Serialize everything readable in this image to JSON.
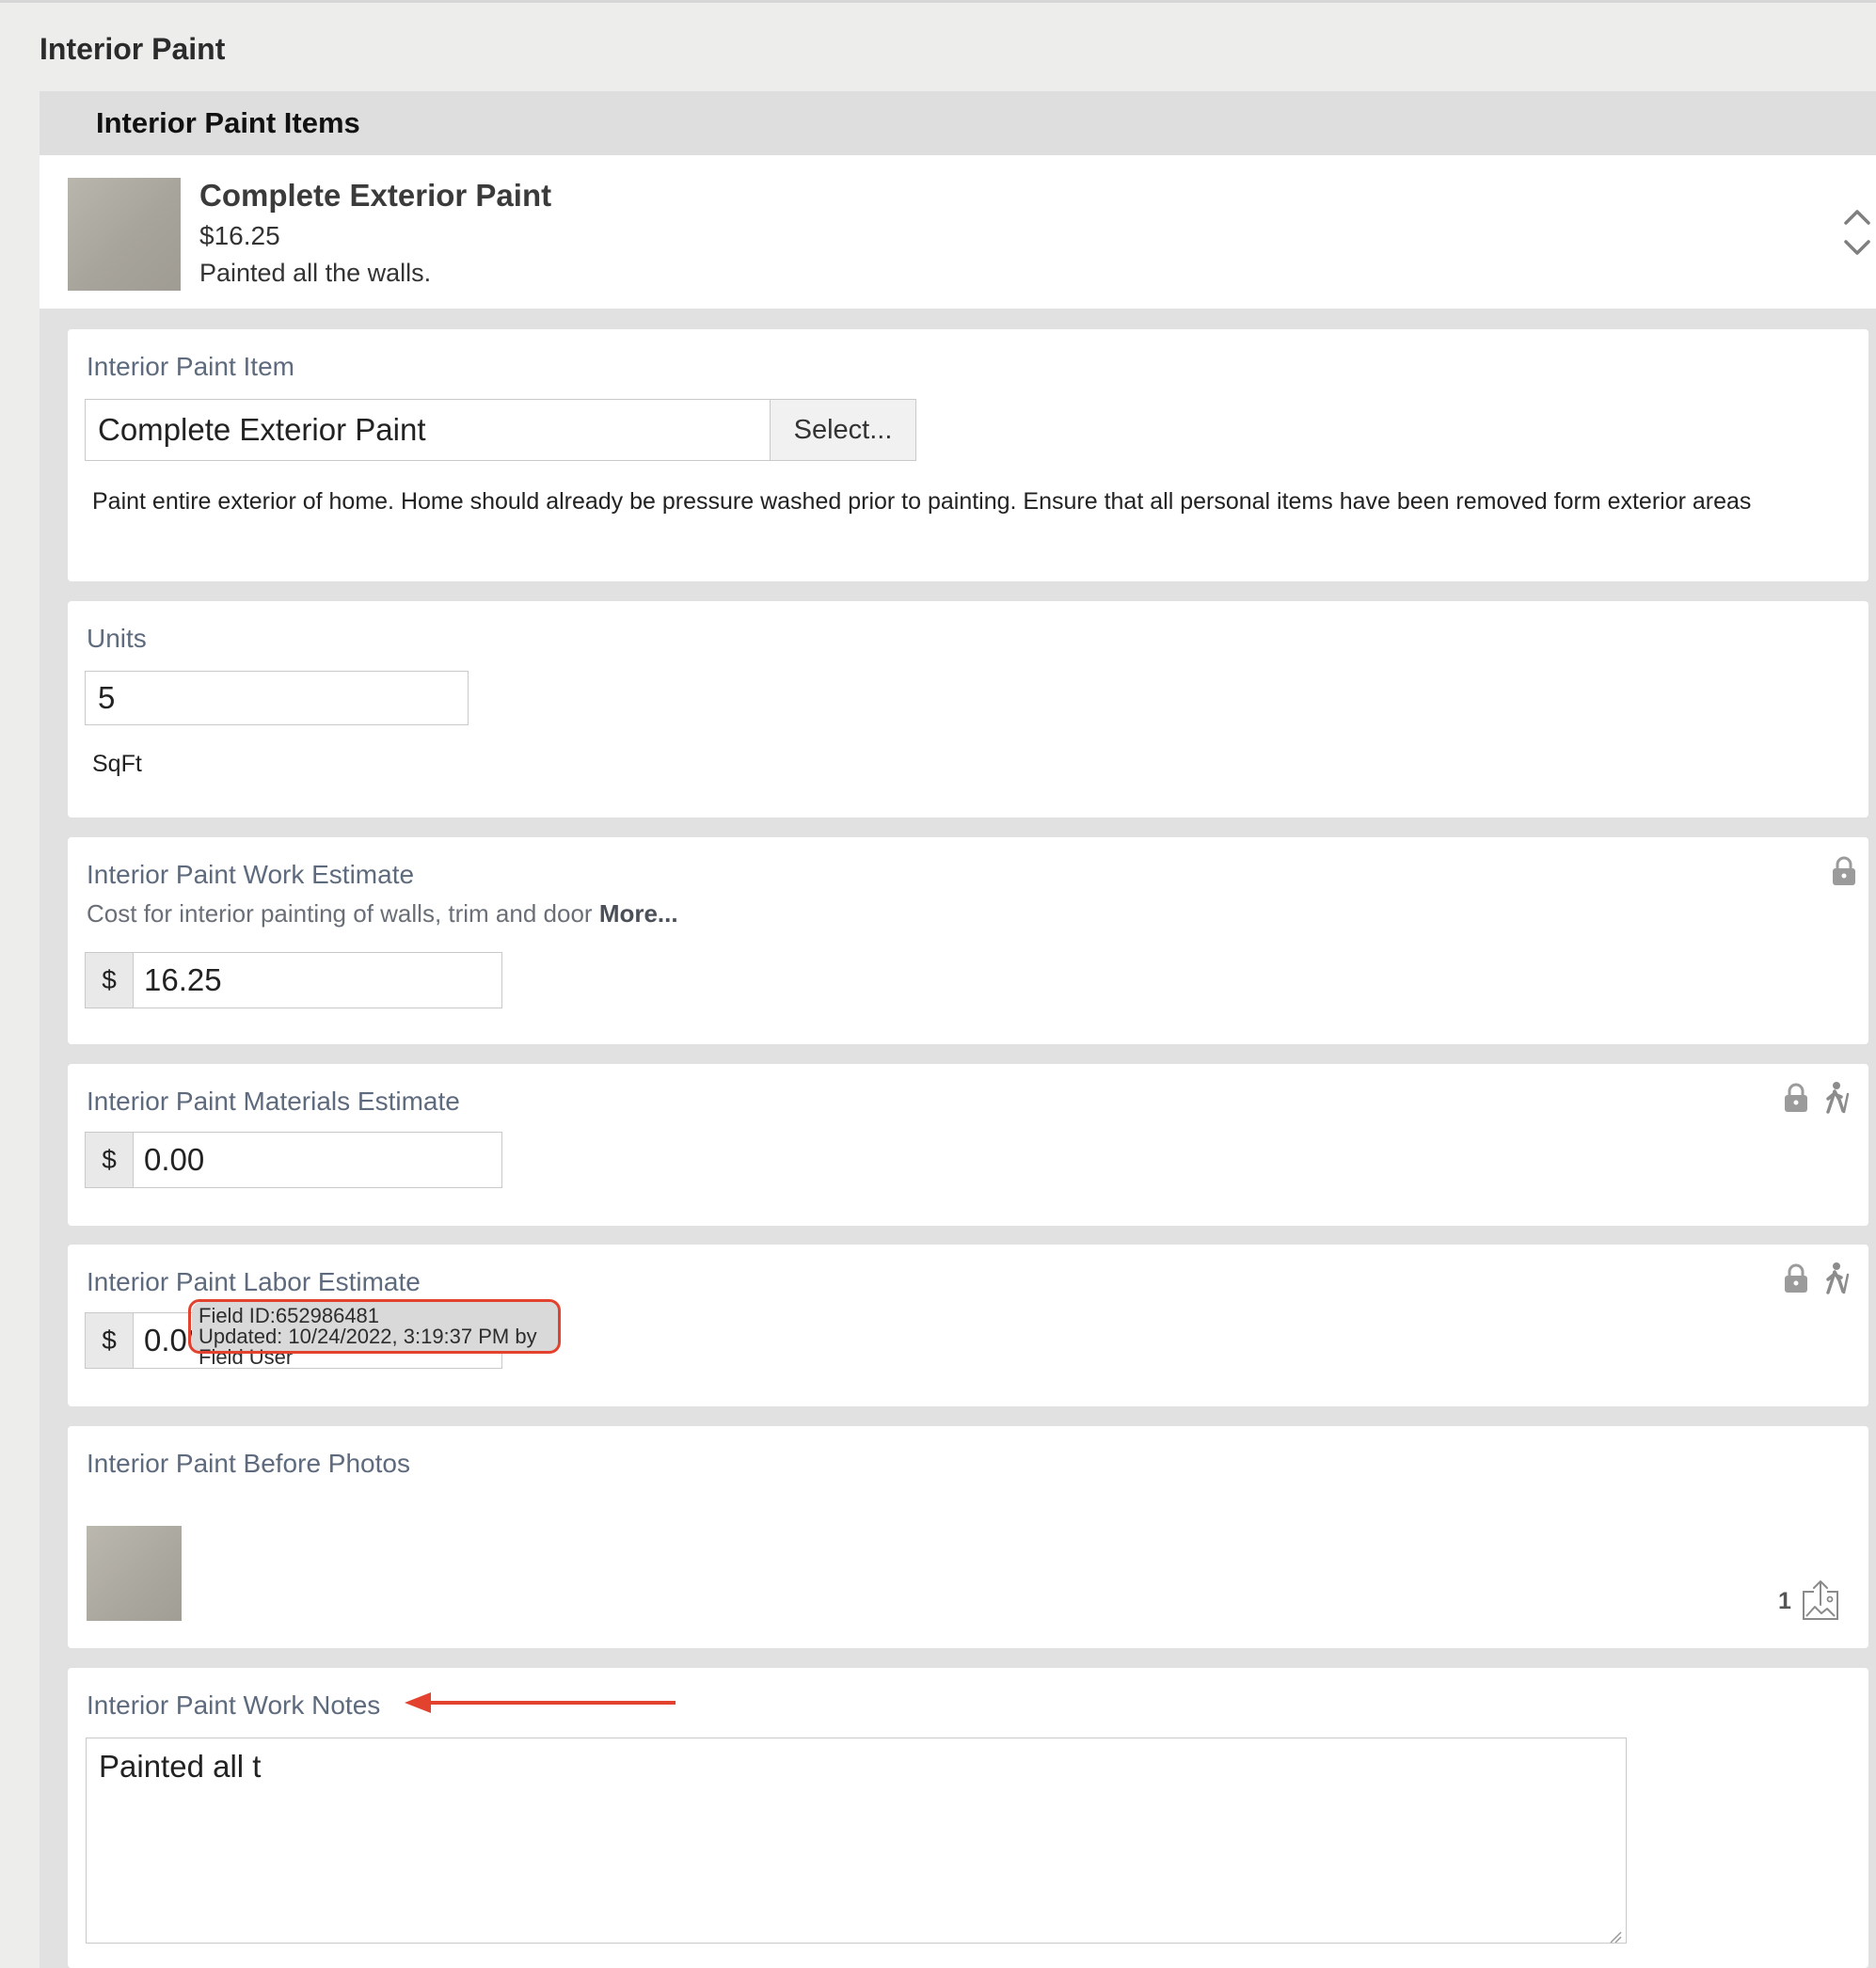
{
  "page": {
    "section_title": "Interior Paint"
  },
  "items_panel": {
    "header": "Interior Paint Items",
    "summary": {
      "name": "Complete Exterior Paint",
      "price": "$16.25",
      "note": "Painted all the walls."
    }
  },
  "fields": {
    "item": {
      "label": "Interior Paint Item",
      "value": "Complete Exterior Paint",
      "select_label": "Select...",
      "description": "Paint entire exterior of home. Home should already be pressure washed prior to painting. Ensure that all personal items have been removed form exterior areas"
    },
    "units": {
      "label": "Units",
      "value": "5",
      "unit": "SqFt"
    },
    "work_estimate": {
      "label": "Interior Paint Work Estimate",
      "help": "Cost for interior painting of walls, trim and door",
      "more": "More...",
      "currency": "$",
      "value": "16.25"
    },
    "materials_estimate": {
      "label": "Interior Paint Materials Estimate",
      "currency": "$",
      "value": "0.00"
    },
    "labor_estimate": {
      "label": "Interior Paint Labor Estimate",
      "currency": "$",
      "value": "0.00"
    },
    "before_photos": {
      "label": "Interior Paint Before Photos",
      "count": "1"
    },
    "work_notes": {
      "label": "Interior Paint Work Notes",
      "value": "Painted all t"
    }
  },
  "tooltip": {
    "field_id": "Field ID:652986481",
    "updated": "Updated: 10/24/2022, 3:19:37 PM by Field User"
  },
  "icons": {
    "reorder": "chevron-up-down-icon",
    "lock": "lock-icon",
    "hiker": "hiker-icon",
    "upload_photo": "upload-photo-icon"
  },
  "colors": {
    "annotation": "#e3432e",
    "label": "#5e6a7d"
  }
}
